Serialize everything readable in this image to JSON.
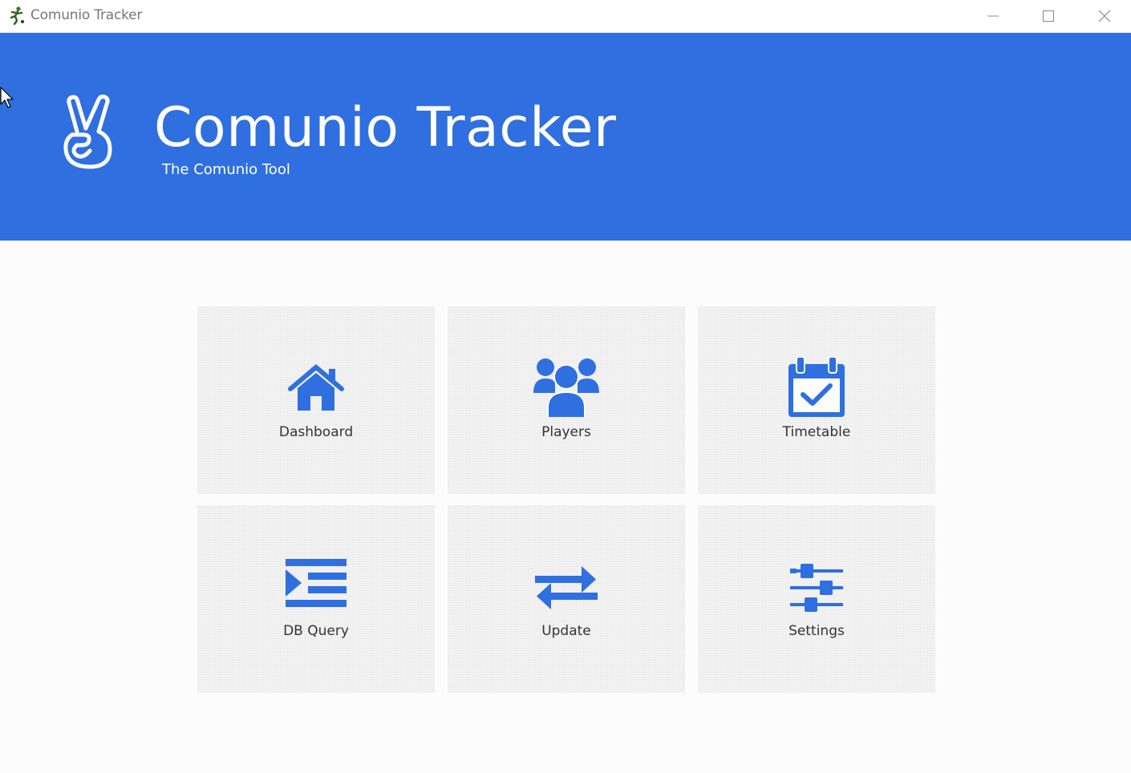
{
  "window": {
    "title": "Comunio Tracker"
  },
  "header": {
    "title": "Comunio Tracker",
    "subtitle": "The Comunio Tool",
    "background_color": "#2f6fe0"
  },
  "tiles": [
    {
      "label": "Dashboard",
      "icon": "home-icon"
    },
    {
      "label": "Players",
      "icon": "users-icon"
    },
    {
      "label": "Timetable",
      "icon": "calendar-check-icon"
    },
    {
      "label": "DB Query",
      "icon": "indent-list-icon"
    },
    {
      "label": "Update",
      "icon": "exchange-arrows-icon"
    },
    {
      "label": "Settings",
      "icon": "sliders-icon"
    }
  ],
  "colors": {
    "accent": "#2f6fe0",
    "tile_bg": "#f2f2f2",
    "text": "#333333"
  }
}
